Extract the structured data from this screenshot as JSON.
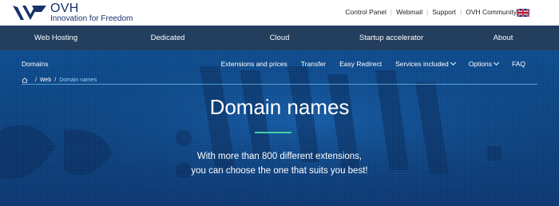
{
  "header": {
    "logo_title": "OVH",
    "logo_tagline": "Innovation for Freedom",
    "links": [
      "Control Panel",
      "Webmail",
      "Support",
      "OVH Community"
    ],
    "flag_icon": "uk-flag-icon"
  },
  "main_nav": {
    "items": [
      "Web Hosting",
      "Dedicated",
      "Cloud",
      "Startup accelerator",
      "About"
    ]
  },
  "sub_nav": {
    "title": "Domains",
    "items": [
      {
        "label": "Extensions and prices"
      },
      {
        "label": "Transfer"
      },
      {
        "label": "Easy Redirect"
      },
      {
        "label": "Services included"
      },
      {
        "label": "Options"
      },
      {
        "label": "FAQ"
      }
    ]
  },
  "breadcrumb": {
    "home_icon": "home-icon",
    "web": "Web",
    "current": "Domain names"
  },
  "hero": {
    "title": "Domain names",
    "line1": "With more than 800 different extensions,",
    "line2": "you can choose the one that suits you best!"
  },
  "colors": {
    "brand": "#16336a",
    "nav_bg": "#243e5e",
    "hero_bg": "#0a3f7c",
    "accent": "#48d1a6",
    "breadcrumb_current": "#8fd3ff"
  }
}
